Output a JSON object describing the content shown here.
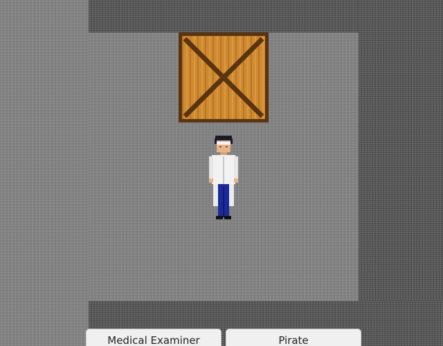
{
  "scene": {
    "entities": [
      {
        "type": "crate",
        "icon": "wooden-crate-icon"
      },
      {
        "type": "character",
        "icon": "medical-examiner-character"
      }
    ]
  },
  "choices": {
    "medical_examiner_label": "Medical Examiner",
    "pirate_label": "Pirate"
  },
  "colors": {
    "wall": "#5b5b5b",
    "floor": "#828282",
    "crate_wood": "#d08a30",
    "crate_frame": "#5a3410",
    "button_bg": "#f0f0f0"
  }
}
